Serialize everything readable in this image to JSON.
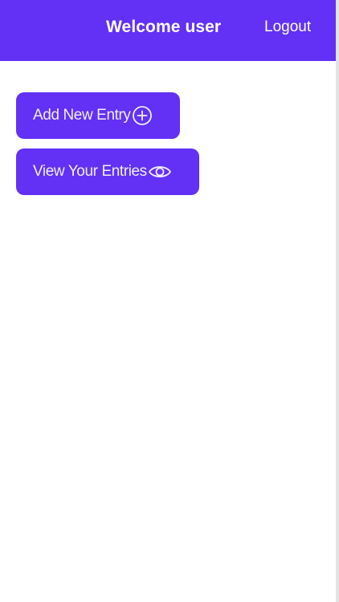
{
  "header": {
    "welcome_text": "Welcome user",
    "logout_label": "Logout"
  },
  "actions": {
    "add_entry_label": "Add New Entry",
    "add_entry_icon": "plus-circle-icon",
    "view_entries_label": "View Your Entries",
    "view_entries_icon": "eye-icon"
  },
  "colors": {
    "accent": "#6231f5",
    "background": "#ffffff",
    "text_on_accent": "#ffffff"
  }
}
